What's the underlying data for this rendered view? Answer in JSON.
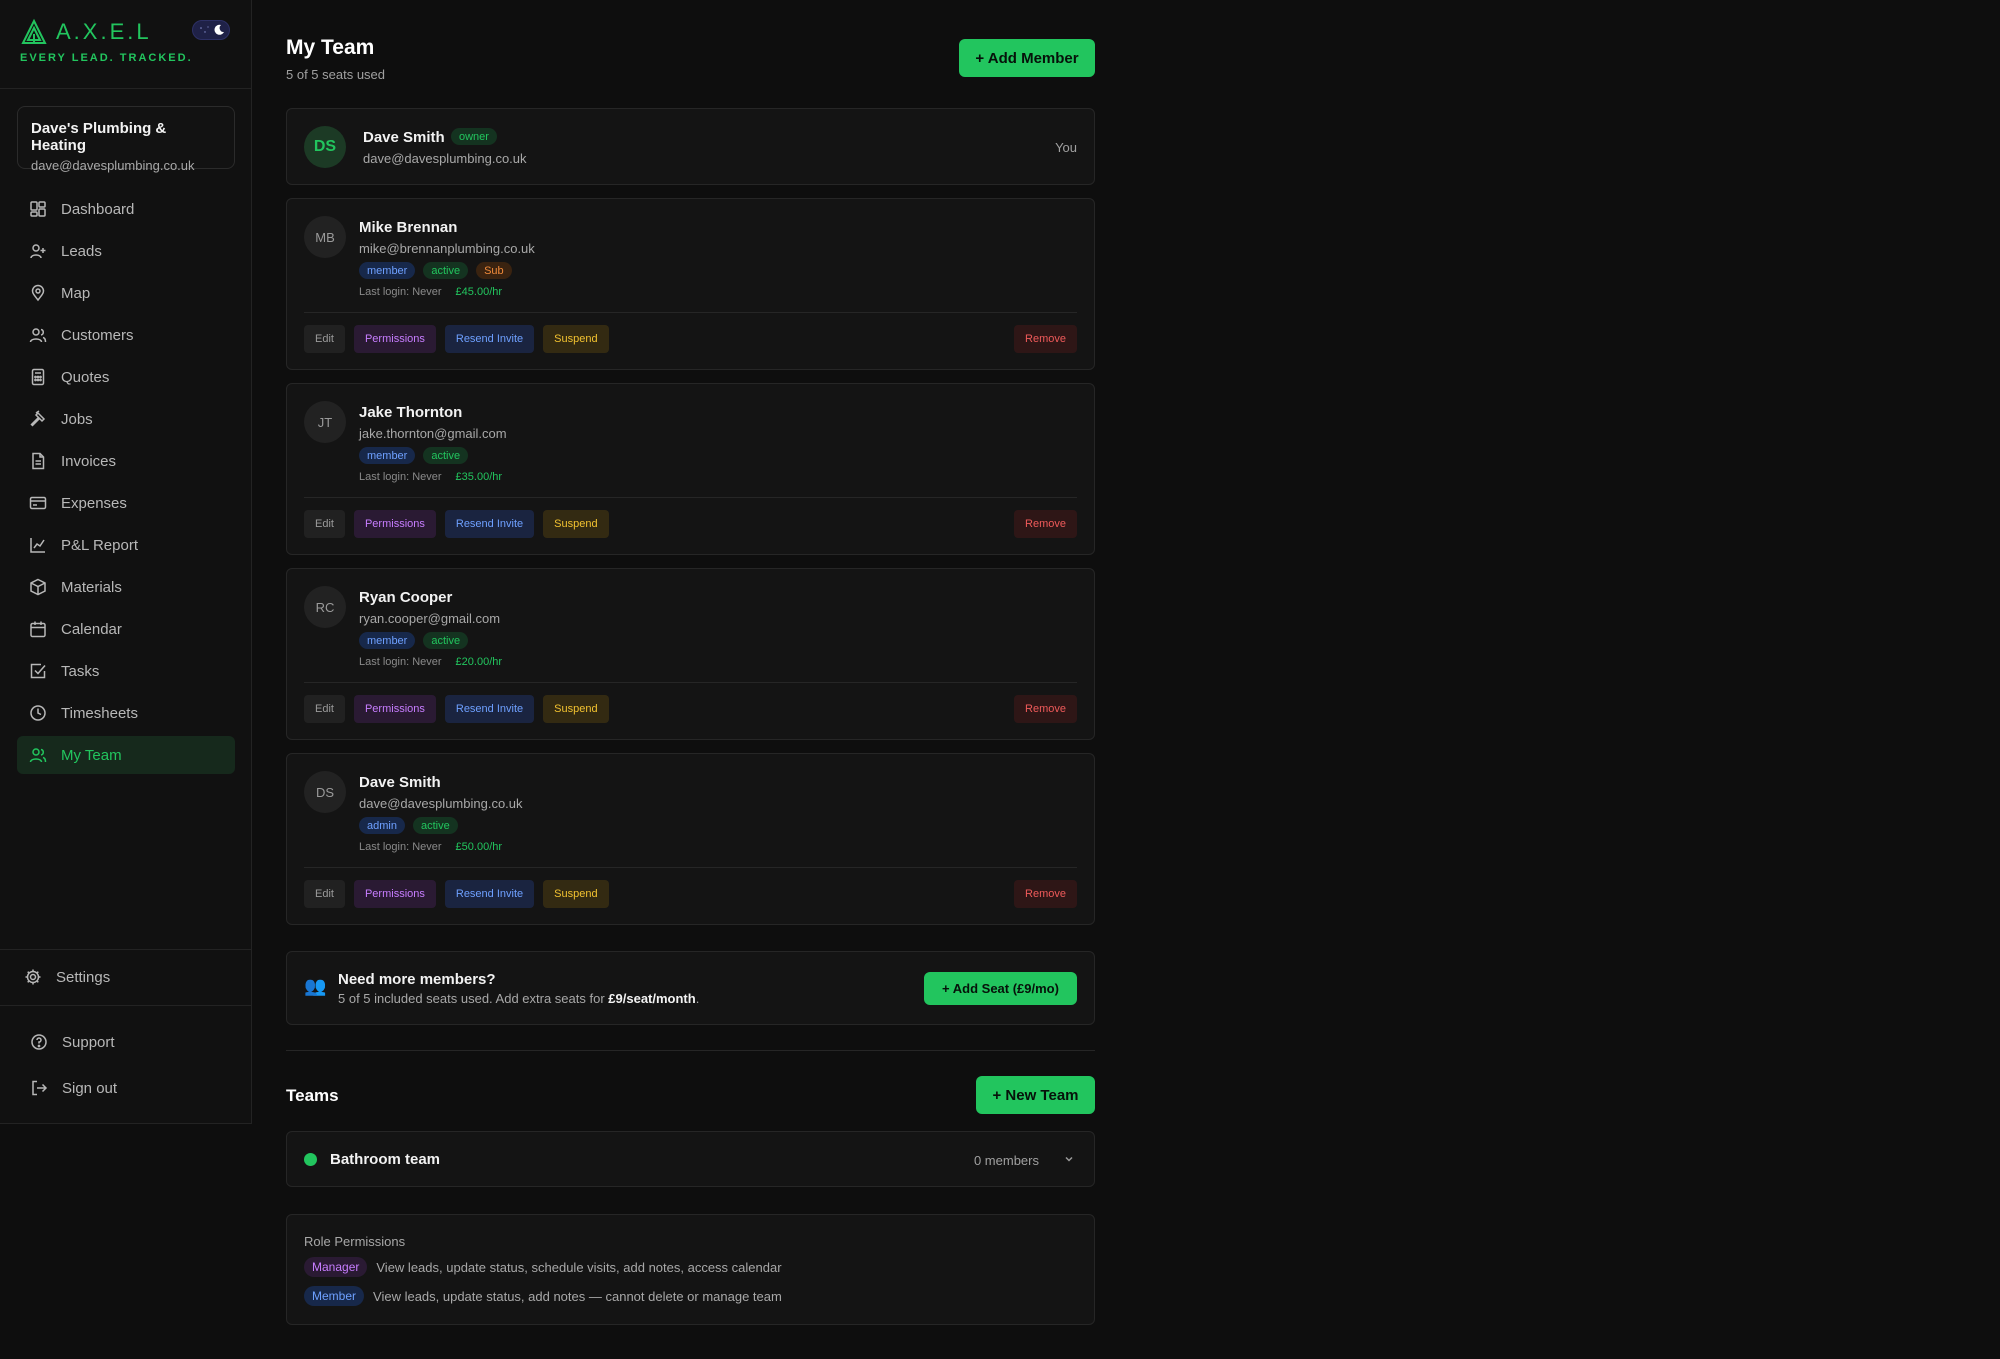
{
  "brand": {
    "name": "A.X.E.L",
    "tagline": "EVERY LEAD. TRACKED.",
    "accent": "#22c55e"
  },
  "company": {
    "name": "Dave's Plumbing & Heating",
    "email": "dave@davesplumbing.co.uk"
  },
  "nav": [
    {
      "label": "Dashboard",
      "icon": "dashboard-icon"
    },
    {
      "label": "Leads",
      "icon": "user-plus-icon"
    },
    {
      "label": "Map",
      "icon": "map-pin-icon"
    },
    {
      "label": "Customers",
      "icon": "users-icon"
    },
    {
      "label": "Quotes",
      "icon": "calculator-icon"
    },
    {
      "label": "Jobs",
      "icon": "hammer-icon"
    },
    {
      "label": "Invoices",
      "icon": "file-text-icon"
    },
    {
      "label": "Expenses",
      "icon": "credit-card-icon"
    },
    {
      "label": "P&L Report",
      "icon": "line-chart-icon"
    },
    {
      "label": "Materials",
      "icon": "package-icon"
    },
    {
      "label": "Calendar",
      "icon": "calendar-icon"
    },
    {
      "label": "Tasks",
      "icon": "check-square-icon"
    },
    {
      "label": "Timesheets",
      "icon": "clock-icon"
    },
    {
      "label": "My Team",
      "icon": "users-icon",
      "active": true
    }
  ],
  "bottom_nav": {
    "settings": "Settings",
    "support": "Support",
    "signout": "Sign out"
  },
  "header": {
    "title": "My Team",
    "subtitle": "5 of 5 seats used",
    "add_member": "+ Add Member"
  },
  "owner": {
    "initials": "DS",
    "name": "Dave Smith",
    "role": "owner",
    "email": "dave@davesplumbing.co.uk",
    "you": "You"
  },
  "members": [
    {
      "initials": "MB",
      "name": "Mike Brennan",
      "email": "mike@brennanplumbing.co.uk",
      "role": "member",
      "status": "active",
      "extra": "Sub",
      "last_login": "Last login: Never",
      "rate": "£45.00/hr"
    },
    {
      "initials": "JT",
      "name": "Jake Thornton",
      "email": "jake.thornton@gmail.com",
      "role": "member",
      "status": "active",
      "last_login": "Last login: Never",
      "rate": "£35.00/hr"
    },
    {
      "initials": "RC",
      "name": "Ryan Cooper",
      "email": "ryan.cooper@gmail.com",
      "role": "member",
      "status": "active",
      "last_login": "Last login: Never",
      "rate": "£20.00/hr"
    },
    {
      "initials": "DS",
      "name": "Dave Smith",
      "email": "dave@davesplumbing.co.uk",
      "role": "admin",
      "status": "active",
      "last_login": "Last login: Never",
      "rate": "£50.00/hr"
    }
  ],
  "actions": {
    "edit": "Edit",
    "permissions": "Permissions",
    "resend": "Resend Invite",
    "suspend": "Suspend",
    "remove": "Remove"
  },
  "seats": {
    "icon": "👥",
    "title": "Need more members?",
    "desc_prefix": "5 of 5 included seats used. Add extra seats for ",
    "price": "£9/seat/month",
    "desc_suffix": ".",
    "button": "+ Add Seat (£9/mo)"
  },
  "teams": {
    "title": "Teams",
    "new_team": "+ New Team",
    "items": [
      {
        "name": "Bathroom team",
        "count": "0 members",
        "color": "#22c55e"
      }
    ]
  },
  "role_permissions": {
    "title": "Role Permissions",
    "rows": [
      {
        "role": "Manager",
        "desc": "View leads, update status, schedule visits, add notes, access calendar"
      },
      {
        "role": "Member",
        "desc": "View leads, update status, add notes — cannot delete or manage team"
      }
    ]
  }
}
